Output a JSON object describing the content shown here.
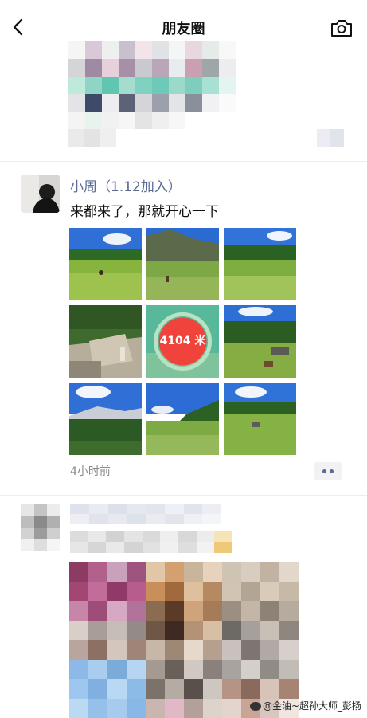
{
  "header": {
    "title": "朋友圈",
    "back_icon": "back-arrow-icon",
    "camera_icon": "camera-icon"
  },
  "post": {
    "username": "小周（1.12加入）",
    "text": "来都来了，那就开心一下",
    "time": "4小时前",
    "workout_card": {
      "distance": "4104",
      "unit": "米"
    }
  },
  "watermark": {
    "text": "@金油~超孙大师_彭扬"
  },
  "colors": {
    "name_blue": "#576b95",
    "time_gray": "#8a8a8a",
    "divider": "#ededed"
  }
}
